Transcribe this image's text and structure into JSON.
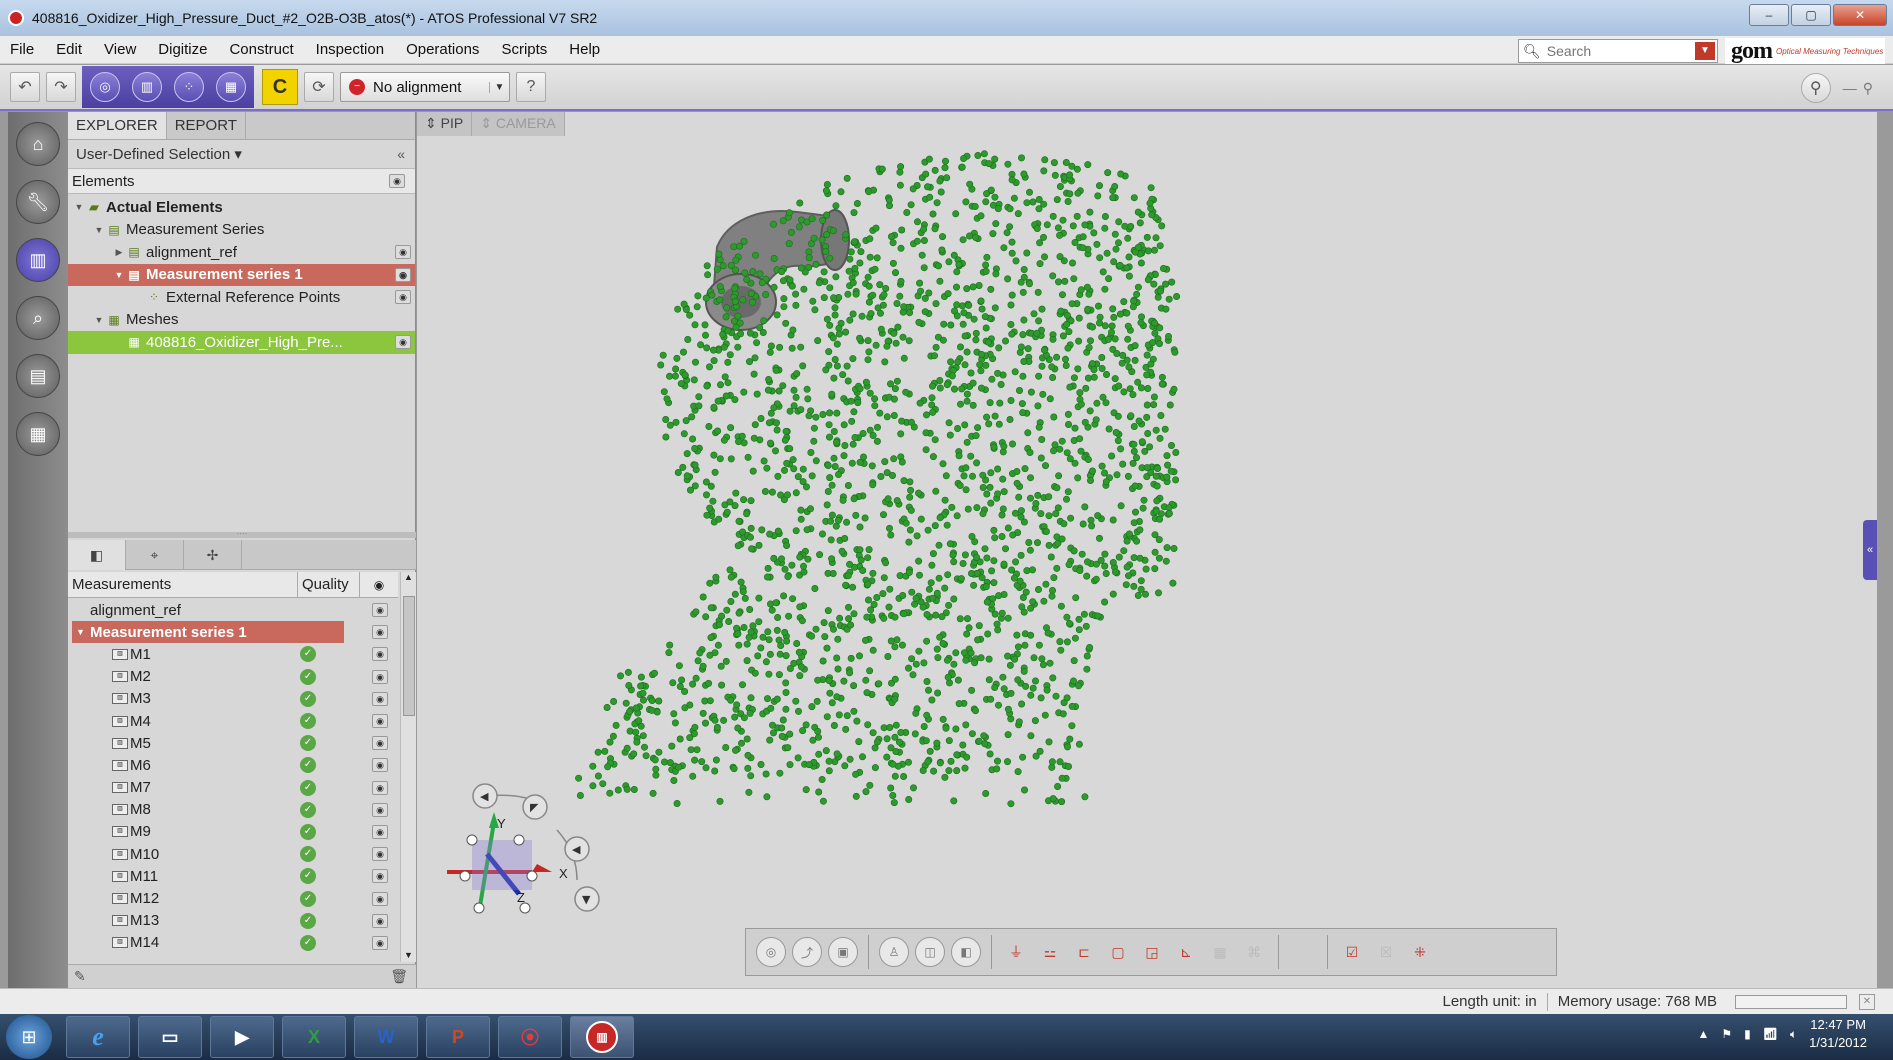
{
  "titlebar": {
    "title": "408816_Oxidizer_High_Pressure_Duct_#2_O2B-O3B_atos(*) - ATOS Professional V7 SR2",
    "min": "–",
    "max": "▢",
    "close": "✕"
  },
  "menu": [
    "File",
    "Edit",
    "View",
    "Digitize",
    "Construct",
    "Inspection",
    "Operations",
    "Scripts",
    "Help"
  ],
  "search": {
    "placeholder": "Search"
  },
  "logo": {
    "brand": "gom",
    "tagline": "Optical Measuring Techniques"
  },
  "toolbar": {
    "alignment_label": "No alignment",
    "help": "?"
  },
  "explorer": {
    "tabs": [
      "EXPLORER",
      "REPORT"
    ],
    "selection": "User-Defined Selection ▾",
    "elements_header": "Elements",
    "tree": [
      {
        "label": "Actual Elements",
        "level": 0,
        "bold": true
      },
      {
        "label": "Measurement Series",
        "level": 1
      },
      {
        "label": "alignment_ref",
        "level": 2
      },
      {
        "label": "Measurement series 1",
        "level": 2,
        "state": "red"
      },
      {
        "label": "External Reference Points",
        "level": 3
      },
      {
        "label": "Meshes",
        "level": 1
      },
      {
        "label": "408816_Oxidizer_High_Pre...",
        "level": 2,
        "state": "green"
      }
    ]
  },
  "measurements": {
    "header": {
      "name": "Measurements",
      "quality": "Quality"
    },
    "alignment_ref": "alignment_ref",
    "series": "Measurement series 1",
    "items": [
      "M1",
      "M2",
      "M3",
      "M4",
      "M5",
      "M6",
      "M7",
      "M8",
      "M9",
      "M10",
      "M11",
      "M12",
      "M13",
      "M14"
    ]
  },
  "viewport": {
    "tabs": [
      "PIP",
      "CAMERA"
    ],
    "axis_labels": {
      "x": "X",
      "y": "Y",
      "z": "Z"
    }
  },
  "statusbar": {
    "length_unit": "Length unit: in",
    "memory": "Memory usage: 768 MB"
  },
  "taskbar": {
    "time": "12:47 PM",
    "date": "1/31/2012"
  },
  "colors": {
    "accent_purple": "#5a4fb4",
    "point_green": "#2e9a2e",
    "selected_red": "#c9695e",
    "selected_green": "#8cc63f"
  }
}
